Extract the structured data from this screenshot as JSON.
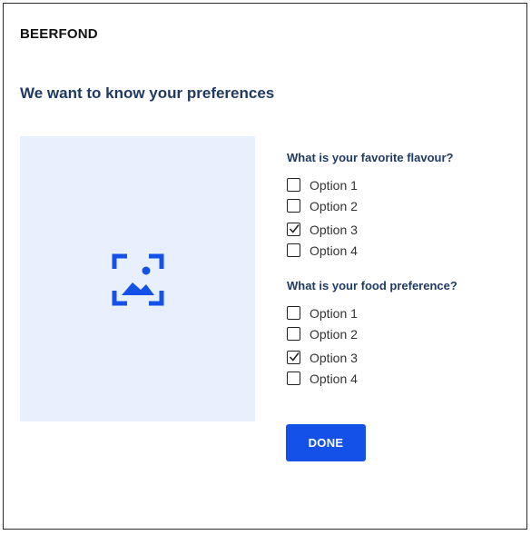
{
  "brand": "BEERFOND",
  "title": "We want to know your preferences",
  "image": {
    "icon": "image-icon"
  },
  "questions": [
    {
      "label": "What is your favorite flavour?",
      "options": [
        {
          "label": "Option 1",
          "checked": false
        },
        {
          "label": "Option 2",
          "checked": false
        },
        {
          "label": "Option 3",
          "checked": true
        },
        {
          "label": "Option 4",
          "checked": false
        }
      ]
    },
    {
      "label": "What is your food preference?",
      "options": [
        {
          "label": "Option 1",
          "checked": false
        },
        {
          "label": "Option 2",
          "checked": false
        },
        {
          "label": "Option 3",
          "checked": true
        },
        {
          "label": "Option 4",
          "checked": false
        }
      ]
    }
  ],
  "done_label": "DONE",
  "colors": {
    "accent": "#1451e8",
    "heading": "#1f3a63",
    "image_bg": "#e8f0fd"
  }
}
